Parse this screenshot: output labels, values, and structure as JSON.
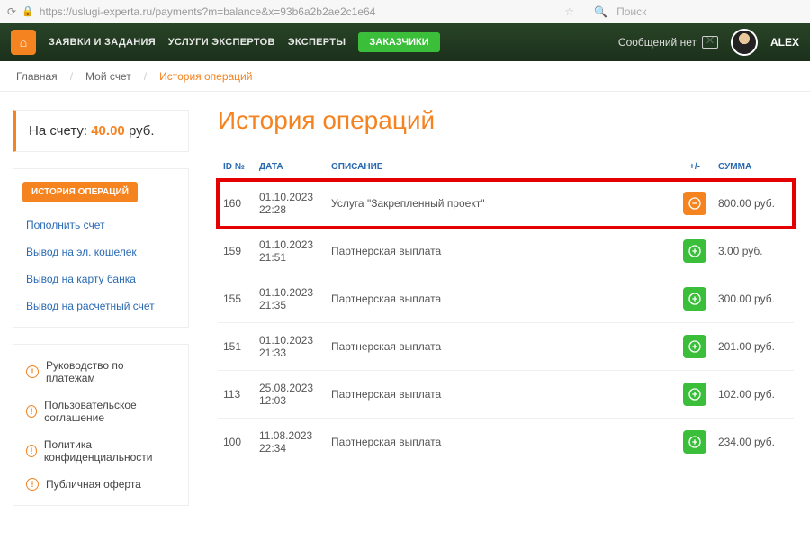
{
  "browser": {
    "url": "https://uslugi-experta.ru/payments?m=balance&x=93b6a2b2ae2c1e64",
    "search_placeholder": "Поиск"
  },
  "topnav": {
    "items": [
      "ЗАЯВКИ И ЗАДАНИЯ",
      "УСЛУГИ ЭКСПЕРТОВ",
      "ЭКСПЕРТЫ"
    ],
    "pill": "ЗАКАЗЧИКИ",
    "messages_label": "Сообщений нет",
    "username": "ALEX"
  },
  "breadcrumbs": {
    "home": "Главная",
    "account": "Мой счет",
    "current": "История операций"
  },
  "balance": {
    "label": "На счету:",
    "amount": "40.00",
    "currency": "руб."
  },
  "sidebar": {
    "active_btn": "ИСТОРИЯ ОПЕРАЦИЙ",
    "links": [
      "Пополнить счет",
      "Вывод на эл. кошелек",
      "Вывод на карту банка",
      "Вывод на расчетный счет"
    ],
    "docs": [
      "Руководство по платежам",
      "Пользовательское соглашение",
      "Политика конфиденциальности",
      "Публичная оферта"
    ]
  },
  "page_title": "История операций",
  "columns": {
    "id": "ID №",
    "date": "ДАТА",
    "desc": "ОПИСАНИЕ",
    "pm": "+/-",
    "sum": "СУММА"
  },
  "rows": [
    {
      "id": "160",
      "date": "01.10.2023",
      "time": "22:28",
      "desc": "Услуга \"Закрепленный проект\"",
      "sign": "minus",
      "sum": "800.00 руб.",
      "highlight": true
    },
    {
      "id": "159",
      "date": "01.10.2023",
      "time": "21:51",
      "desc": "Партнерская выплата",
      "sign": "plus",
      "sum": "3.00 руб."
    },
    {
      "id": "155",
      "date": "01.10.2023",
      "time": "21:35",
      "desc": "Партнерская выплата",
      "sign": "plus",
      "sum": "300.00 руб."
    },
    {
      "id": "151",
      "date": "01.10.2023",
      "time": "21:33",
      "desc": "Партнерская выплата",
      "sign": "plus",
      "sum": "201.00 руб."
    },
    {
      "id": "113",
      "date": "25.08.2023",
      "time": "12:03",
      "desc": "Партнерская выплата",
      "sign": "plus",
      "sum": "102.00 руб."
    },
    {
      "id": "100",
      "date": "11.08.2023",
      "time": "22:34",
      "desc": "Партнерская выплата",
      "sign": "plus",
      "sum": "234.00 руб."
    }
  ]
}
